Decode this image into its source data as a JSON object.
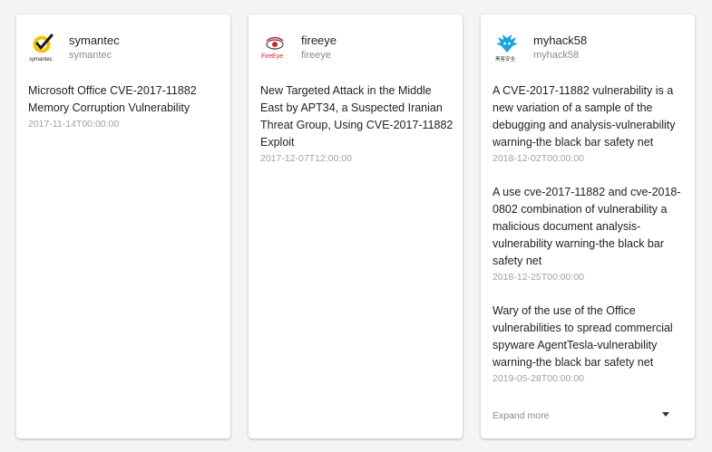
{
  "cards": [
    {
      "vendor": "symantec",
      "vendor_sub": "symantec",
      "logo_icon": "symantec-logo",
      "logo_text": "symantec",
      "entries": [
        {
          "title": "Microsoft Office CVE-2017-11882 Memory Corruption Vulnerability",
          "date": "2017-11-14T00:00:00"
        }
      ]
    },
    {
      "vendor": "fireeye",
      "vendor_sub": "fireeye",
      "logo_icon": "fireeye-logo",
      "logo_text": "FireEye",
      "entries": [
        {
          "title": "New Targeted Attack in the Middle East by APT34, a Suspected Iranian Threat Group, Using CVE-2017-11882 Exploit",
          "date": "2017-12-07T12:00:00"
        }
      ]
    },
    {
      "vendor": "myhack58",
      "vendor_sub": "myhack58",
      "logo_icon": "myhack58-logo",
      "logo_text": "黑客安全",
      "entries": [
        {
          "title": "A CVE-2017-11882 vulnerability is a new variation of a sample of the debugging and analysis-vulnerability warning-the black bar safety net",
          "date": "2018-12-02T00:00:00"
        },
        {
          "title": "A use cve-2017-11882 and cve-2018-0802 combination of vulnerability a malicious document analysis-vulnerability warning-the black bar safety net",
          "date": "2018-12-25T00:00:00"
        },
        {
          "title": "Wary of the use of the Office vulnerabilities to spread commercial spyware AgentTesla-vulnerability warning-the black bar safety net",
          "date": "2019-05-28T00:00:00"
        }
      ],
      "expand_label": "Expand more",
      "expand_icon": "chevron-down-icon"
    }
  ],
  "colors": {
    "background": "#f4f4f4",
    "card": "#ffffff",
    "symantec_yellow": "#f5c300",
    "fireeye_red": "#d4202a",
    "myhack_blue": "#1aa3e0"
  }
}
